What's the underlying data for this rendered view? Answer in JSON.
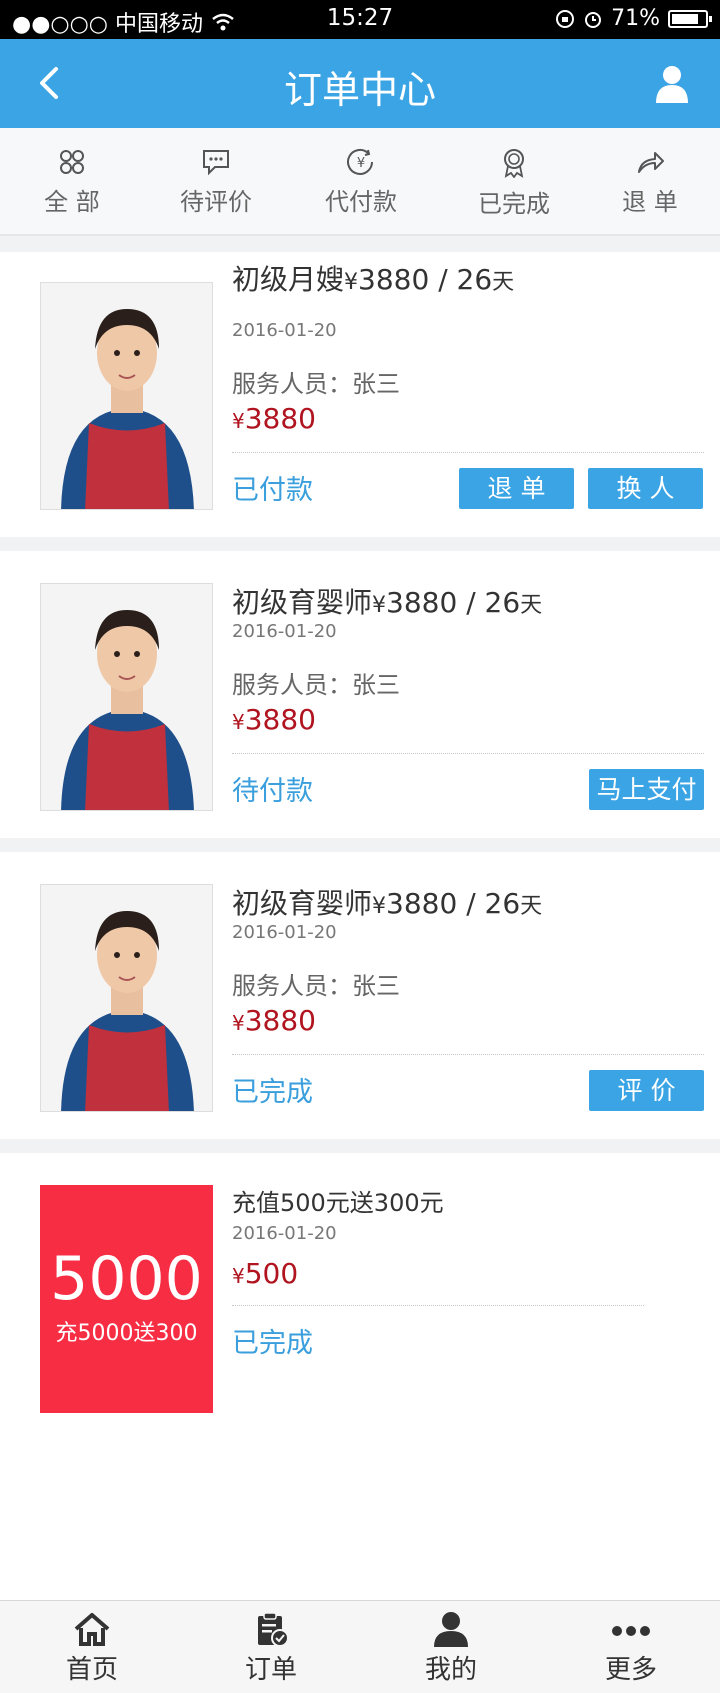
{
  "status_bar": {
    "carrier": "●●○○○ 中国移动",
    "time": "15:27",
    "battery": "71%"
  },
  "header": {
    "title": "订单中心"
  },
  "tabs": [
    {
      "label": "全 部",
      "icon": "grid-icon"
    },
    {
      "label": "待评价",
      "icon": "comment-icon"
    },
    {
      "label": "代付款",
      "icon": "currency-icon"
    },
    {
      "label": "已完成",
      "icon": "badge-icon"
    },
    {
      "label": "退 单",
      "icon": "share-arrow-icon"
    }
  ],
  "orders": [
    {
      "title": "初级月嫂",
      "currency": "¥",
      "price_text": "3880",
      "unit": "/ 26",
      "day": "天",
      "date": "2016-01-20",
      "staff": "服务人员：张三",
      "price": "3880",
      "status": "已付款",
      "buttons": [
        "退 单",
        "换 人"
      ]
    },
    {
      "title": "初级育婴师",
      "currency": "¥",
      "price_text": "3880",
      "unit": "/ 26",
      "day": "天",
      "date": "2016-01-20",
      "staff": "服务人员：张三",
      "price": "3880",
      "status": "待付款",
      "buttons": [
        "马上支付"
      ]
    },
    {
      "title": "初级育婴师",
      "currency": "¥",
      "price_text": "3880",
      "unit": "/ 26",
      "day": "天",
      "date": "2016-01-20",
      "staff": "服务人员：张三",
      "price": "3880",
      "status": "已完成",
      "buttons": [
        "评 价"
      ]
    },
    {
      "title": "充值500元送300元",
      "date": "2016-01-20",
      "currency": "¥",
      "price": "500",
      "status": "已完成",
      "promo_big": "5000",
      "promo_small": "充5000送300"
    }
  ],
  "bottom_nav": [
    {
      "label": "首页",
      "icon": "home-icon"
    },
    {
      "label": "订单",
      "icon": "clipboard-check-icon"
    },
    {
      "label": "我的",
      "icon": "person-icon"
    },
    {
      "label": "更多",
      "icon": "more-dots-icon"
    }
  ],
  "colors": {
    "primary": "#3ba4e4",
    "price": "#b0141f",
    "promo_bg": "#f72d44"
  }
}
